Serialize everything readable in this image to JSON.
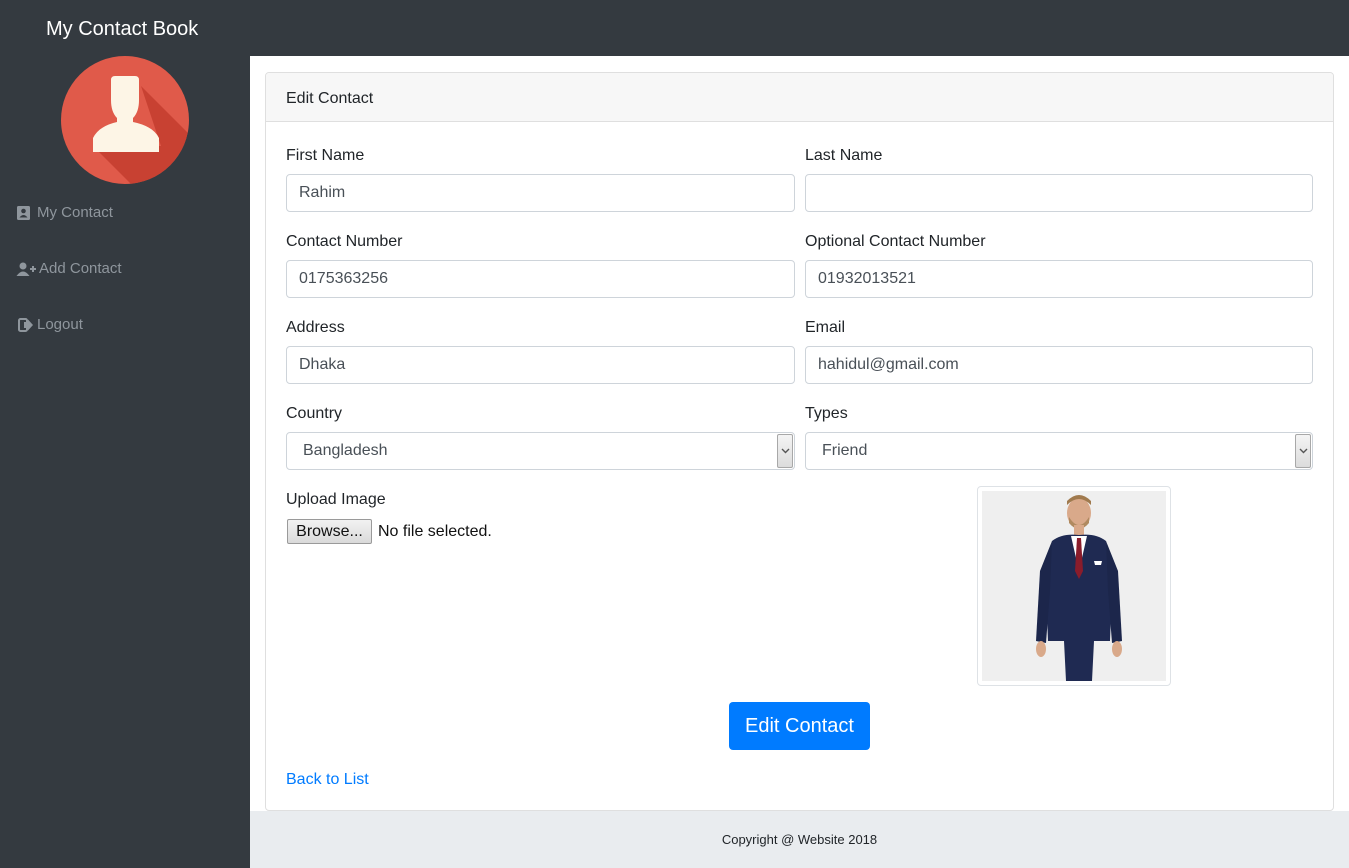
{
  "app": {
    "title": "My Contact Book"
  },
  "sidebar": {
    "items": [
      {
        "label": "My Contact",
        "icon": "address-card-icon"
      },
      {
        "label": "Add Contact",
        "icon": "user-plus-icon"
      },
      {
        "label": "Logout",
        "icon": "sign-out-icon"
      }
    ]
  },
  "form": {
    "header": "Edit Contact",
    "first_name": {
      "label": "First Name",
      "value": "Rahim"
    },
    "last_name": {
      "label": "Last Name",
      "value": ""
    },
    "contact_number": {
      "label": "Contact Number",
      "value": "0175363256"
    },
    "optional_contact_number": {
      "label": "Optional Contact Number",
      "value": "01932013521"
    },
    "address": {
      "label": "Address",
      "value": "Dhaka"
    },
    "email": {
      "label": "Email",
      "value": "hahidul@gmail.com"
    },
    "country": {
      "label": "Country",
      "value": "Bangladesh"
    },
    "types": {
      "label": "Types",
      "value": "Friend"
    },
    "upload": {
      "label": "Upload Image",
      "browse_label": "Browse...",
      "status": "No file selected."
    },
    "submit_label": "Edit Contact",
    "back_label": "Back to List"
  },
  "footer": {
    "text": "Copyright @ Website 2018"
  },
  "colors": {
    "sidebar_bg": "#343a40",
    "primary": "#007bff",
    "avatar_bg": "#e05a4a",
    "footer_bg": "#e9ecef"
  }
}
